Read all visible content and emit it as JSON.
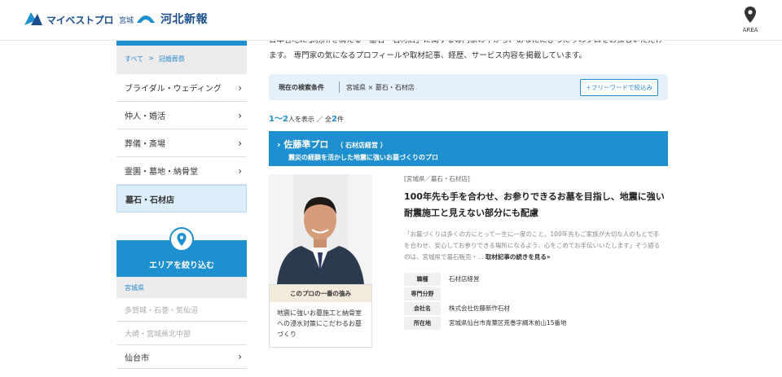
{
  "header": {
    "brand": "マイベストプロ",
    "region": "宮城",
    "partner": "河北新報",
    "area_label": "AREA",
    "accent_color": "#1e8fcf"
  },
  "sidebar": {
    "breadcrumb": [
      "すべて",
      "冠婚葬祭"
    ],
    "categories": [
      {
        "label": "ブライダル・ウェディング",
        "active": false
      },
      {
        "label": "仲人・婚活",
        "active": false
      },
      {
        "label": "葬儀・斎場",
        "active": false
      },
      {
        "label": "霊園・墓地・納骨堂",
        "active": false
      },
      {
        "label": "墓石・石材店",
        "active": true
      }
    ],
    "area_title": "エリアを絞り込む",
    "area_pref": "宮城県",
    "areas": [
      {
        "label": "多賀城・石巻・気仙沼"
      },
      {
        "label": "大崎・宮城県北中部"
      },
      {
        "label": "仙台市"
      }
    ]
  },
  "main": {
    "intro_text": "日本各地に事務所を構える「墓石・石材店」に関する専門家の中から、あなたにぴったりのプロをお探しいただけます。 専門家の気になるプロフィールや取材記事、経歴、サービス内容を掲載しています。",
    "search": {
      "label": "現在の検索条件",
      "value": "宮城県 × 墓石・石材店",
      "button": "＋フリーワードで絞込み"
    },
    "count": {
      "range": "1〜2",
      "shown_suffix": "人を表示 ／ 全",
      "total": "2",
      "total_suffix": "件"
    },
    "pro": {
      "name": "佐藤準プロ",
      "tag": "（ 石材店経営 ）",
      "catch": "震災の経験を活かした地震に強いお墓づくりのプロ",
      "strength_title": "このプロの一番の強み",
      "strength_text": "地震に強いお墓施工と納骨室への浸水対策にこだわるお墓づくり",
      "category": "[宮城県／墓石・石材店]",
      "title": "100年先も手を合わせ、お参りできるお墓を目指し、地震に強い耐震施工と見えない部分にも配慮",
      "excerpt": "「お墓づくりは多くの方にとって一生に一度のこと。100年先もご家族が大切な人のもとで手を合わせ、安心してお参りできる場所になるよう、心をこめてお手伝いいたします」そう語るのは、宮城県で墓石販売・…",
      "more": "取材記事の続きを見る»",
      "info": [
        {
          "key": "職種",
          "value": "石材店経営"
        },
        {
          "key": "専門分野",
          "value": ""
        },
        {
          "key": "会社名",
          "value": "株式会社佐藤新作石材"
        },
        {
          "key": "所在地",
          "value": "宮城県仙台市青葉区荒巻字綱木前山15番地"
        }
      ]
    }
  }
}
